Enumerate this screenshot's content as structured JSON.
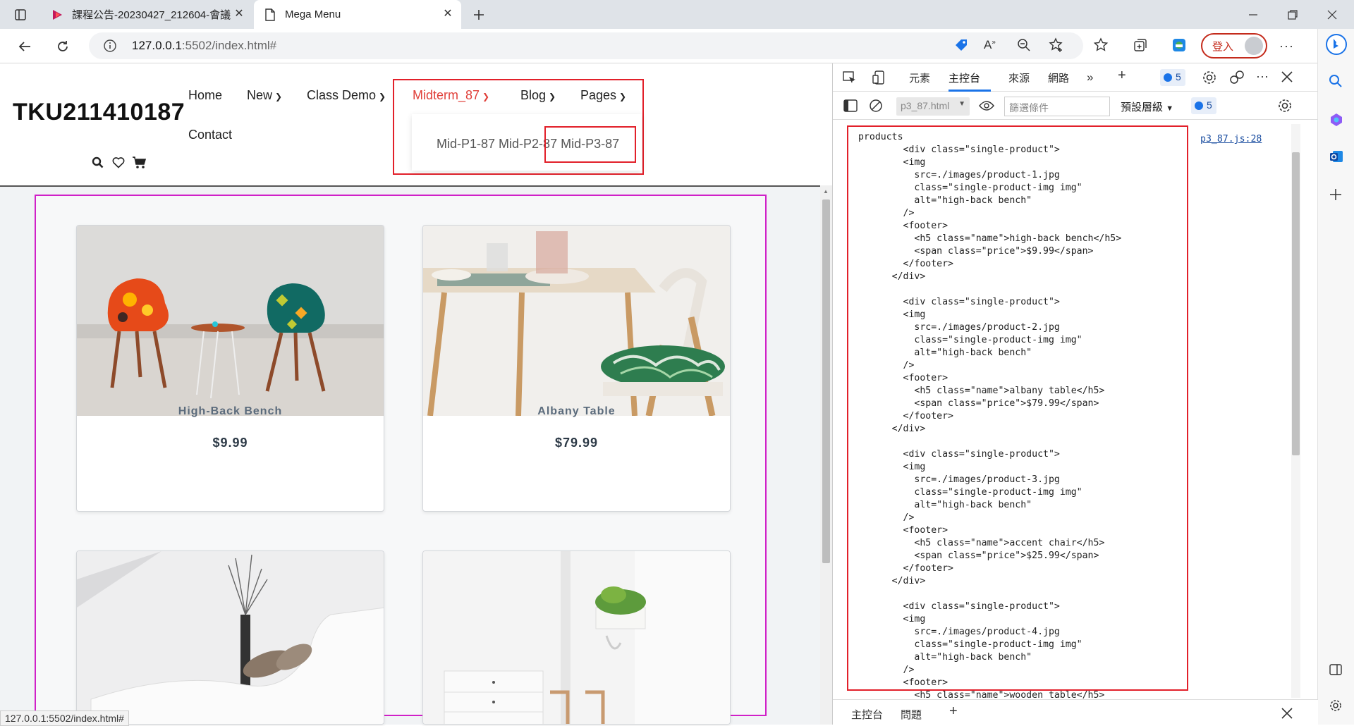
{
  "browser": {
    "tabs": [
      {
        "title": "課程公告-20230427_212604-會議",
        "active": false
      },
      {
        "title": "Mega Menu",
        "active": true
      }
    ],
    "url_host": "127.0.0.1",
    "url_rest": ":5502/index.html#",
    "login_label": "登入",
    "status_url": "127.0.0.1:5502/index.html#"
  },
  "site": {
    "brand": "TKU211410187",
    "nav": {
      "home": "Home",
      "new": "New",
      "class_demo": "Class Demo",
      "midterm": "Midterm_87",
      "blog": "Blog",
      "pages": "Pages",
      "contact": "Contact"
    },
    "mega_menu": {
      "p1": "Mid-P1-87",
      "p2": "Mid-P2-87",
      "p3": "Mid-P3-87"
    },
    "products": [
      {
        "name": "High-Back Bench",
        "price": "$9.99"
      },
      {
        "name": "Albany Table",
        "price": "$79.99"
      },
      {
        "name": "",
        "price": ""
      },
      {
        "name": "",
        "price": ""
      }
    ]
  },
  "devtools": {
    "tabs": {
      "elements": "元素",
      "console": "主控台",
      "sources": "來源",
      "network": "網路"
    },
    "issues_count": "5",
    "context": "p3_87.html",
    "filter_placeholder": "篩選條件",
    "levels": "預設層級",
    "console_badge": "5",
    "source_link": "p3_87.js:28",
    "code": "products\n        <div class=\"single-product\">\n        <img\n          src=./images/product-1.jpg\n          class=\"single-product-img img\"\n          alt=\"high-back bench\"\n        />\n        <footer>\n          <h5 class=\"name\">high-back bench</h5>\n          <span class=\"price\">$9.99</span>\n        </footer>\n      </div>\n\n        <div class=\"single-product\">\n        <img\n          src=./images/product-2.jpg\n          class=\"single-product-img img\"\n          alt=\"high-back bench\"\n        />\n        <footer>\n          <h5 class=\"name\">albany table</h5>\n          <span class=\"price\">$79.99</span>\n        </footer>\n      </div>\n\n        <div class=\"single-product\">\n        <img\n          src=./images/product-3.jpg\n          class=\"single-product-img img\"\n          alt=\"high-back bench\"\n        />\n        <footer>\n          <h5 class=\"name\">accent chair</h5>\n          <span class=\"price\">$25.99</span>\n        </footer>\n      </div>\n\n        <div class=\"single-product\">\n        <img\n          src=./images/product-4.jpg\n          class=\"single-product-img img\"\n          alt=\"high-back bench\"\n        />\n        <footer>\n          <h5 class=\"name\">wooden table</h5>",
    "drawer_tabs": {
      "console": "主控台",
      "issues": "問題"
    }
  },
  "colors": {
    "accent_red": "#e2202a",
    "products_outline": "#d020c8",
    "link_blue": "#1a4da0"
  }
}
